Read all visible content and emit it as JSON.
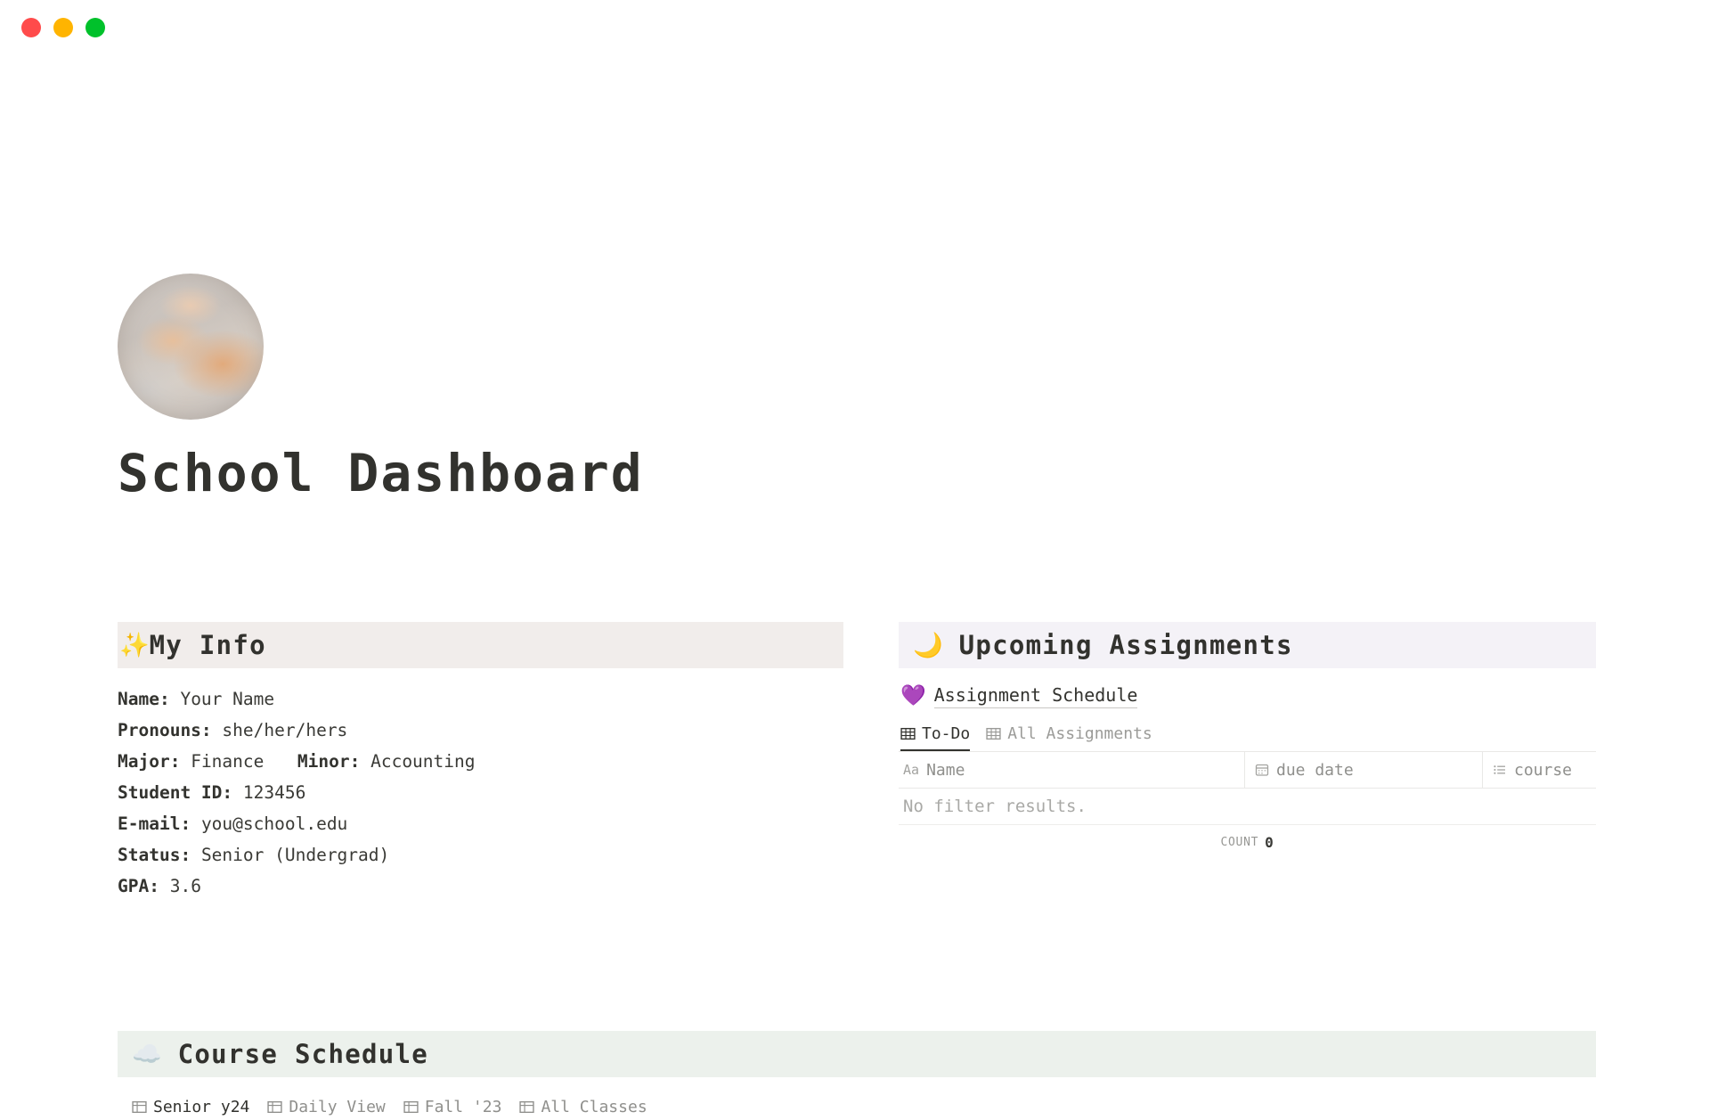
{
  "window": {
    "controls": [
      {
        "name": "close",
        "color": "#FF4B4B"
      },
      {
        "name": "minimize",
        "color": "#FFB400"
      },
      {
        "name": "zoom",
        "color": "#00C12B"
      }
    ]
  },
  "page": {
    "title": "School Dashboard",
    "avatar_alt": "cloud photo avatar"
  },
  "my_info": {
    "emoji": "✨",
    "heading": "My Info",
    "background": "#F1EDEB",
    "rows": [
      {
        "label": "Name:",
        "value": "Your Name"
      },
      {
        "label": "Pronouns:",
        "value": "she/her/hers"
      },
      {
        "label": "Major:",
        "value": "Finance",
        "label2": "Minor:",
        "value2": "Accounting"
      },
      {
        "label": "Student ID:",
        "value": " 123456"
      },
      {
        "label": "E-mail:",
        "value": "you@school.edu"
      },
      {
        "label": "Status:",
        "value": "Senior (Undergrad)"
      },
      {
        "label": "GPA:",
        "value": "3.6"
      }
    ]
  },
  "upcoming": {
    "emoji": "🌙",
    "heading": "Upcoming Assignments",
    "background": "#F4F2F7",
    "database_link": {
      "emoji": "💜",
      "label": "Assignment Schedule"
    },
    "tabs": [
      {
        "label": "To-Do",
        "icon": "table-icon",
        "active": true
      },
      {
        "label": "All Assignments",
        "icon": "table-icon",
        "active": false
      }
    ],
    "columns": [
      {
        "label": "Name",
        "icon": "text-icon"
      },
      {
        "label": "due date",
        "icon": "calendar-icon"
      },
      {
        "label": "course",
        "icon": "multi-select-icon"
      }
    ],
    "rows": [],
    "empty_message": "No filter results.",
    "footer": {
      "label": "COUNT",
      "value": "0"
    }
  },
  "course_schedule": {
    "emoji": "☁️",
    "heading": "Course Schedule",
    "background": "#ECF1EC",
    "tabs": [
      {
        "label": "Senior y24",
        "icon": "table-icon",
        "active": true
      },
      {
        "label": "Daily View",
        "icon": "table-icon",
        "active": false
      },
      {
        "label": "Fall '23",
        "icon": "table-icon",
        "active": false
      },
      {
        "label": "All Classes",
        "icon": "table-icon",
        "active": false
      }
    ]
  }
}
